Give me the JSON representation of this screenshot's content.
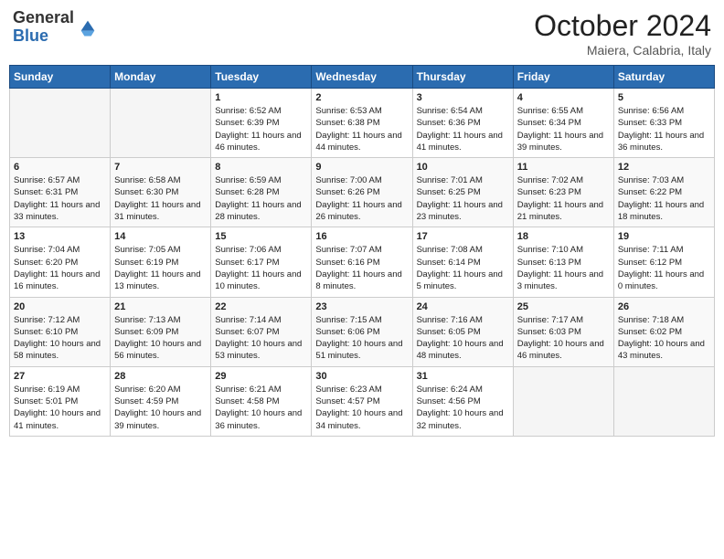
{
  "header": {
    "logo_general": "General",
    "logo_blue": "Blue",
    "month_year": "October 2024",
    "location": "Maiera, Calabria, Italy"
  },
  "days_of_week": [
    "Sunday",
    "Monday",
    "Tuesday",
    "Wednesday",
    "Thursday",
    "Friday",
    "Saturday"
  ],
  "weeks": [
    [
      {
        "day": null,
        "content": ""
      },
      {
        "day": null,
        "content": ""
      },
      {
        "day": "1",
        "content": "Sunrise: 6:52 AM\nSunset: 6:39 PM\nDaylight: 11 hours and 46 minutes."
      },
      {
        "day": "2",
        "content": "Sunrise: 6:53 AM\nSunset: 6:38 PM\nDaylight: 11 hours and 44 minutes."
      },
      {
        "day": "3",
        "content": "Sunrise: 6:54 AM\nSunset: 6:36 PM\nDaylight: 11 hours and 41 minutes."
      },
      {
        "day": "4",
        "content": "Sunrise: 6:55 AM\nSunset: 6:34 PM\nDaylight: 11 hours and 39 minutes."
      },
      {
        "day": "5",
        "content": "Sunrise: 6:56 AM\nSunset: 6:33 PM\nDaylight: 11 hours and 36 minutes."
      }
    ],
    [
      {
        "day": "6",
        "content": "Sunrise: 6:57 AM\nSunset: 6:31 PM\nDaylight: 11 hours and 33 minutes."
      },
      {
        "day": "7",
        "content": "Sunrise: 6:58 AM\nSunset: 6:30 PM\nDaylight: 11 hours and 31 minutes."
      },
      {
        "day": "8",
        "content": "Sunrise: 6:59 AM\nSunset: 6:28 PM\nDaylight: 11 hours and 28 minutes."
      },
      {
        "day": "9",
        "content": "Sunrise: 7:00 AM\nSunset: 6:26 PM\nDaylight: 11 hours and 26 minutes."
      },
      {
        "day": "10",
        "content": "Sunrise: 7:01 AM\nSunset: 6:25 PM\nDaylight: 11 hours and 23 minutes."
      },
      {
        "day": "11",
        "content": "Sunrise: 7:02 AM\nSunset: 6:23 PM\nDaylight: 11 hours and 21 minutes."
      },
      {
        "day": "12",
        "content": "Sunrise: 7:03 AM\nSunset: 6:22 PM\nDaylight: 11 hours and 18 minutes."
      }
    ],
    [
      {
        "day": "13",
        "content": "Sunrise: 7:04 AM\nSunset: 6:20 PM\nDaylight: 11 hours and 16 minutes."
      },
      {
        "day": "14",
        "content": "Sunrise: 7:05 AM\nSunset: 6:19 PM\nDaylight: 11 hours and 13 minutes."
      },
      {
        "day": "15",
        "content": "Sunrise: 7:06 AM\nSunset: 6:17 PM\nDaylight: 11 hours and 10 minutes."
      },
      {
        "day": "16",
        "content": "Sunrise: 7:07 AM\nSunset: 6:16 PM\nDaylight: 11 hours and 8 minutes."
      },
      {
        "day": "17",
        "content": "Sunrise: 7:08 AM\nSunset: 6:14 PM\nDaylight: 11 hours and 5 minutes."
      },
      {
        "day": "18",
        "content": "Sunrise: 7:10 AM\nSunset: 6:13 PM\nDaylight: 11 hours and 3 minutes."
      },
      {
        "day": "19",
        "content": "Sunrise: 7:11 AM\nSunset: 6:12 PM\nDaylight: 11 hours and 0 minutes."
      }
    ],
    [
      {
        "day": "20",
        "content": "Sunrise: 7:12 AM\nSunset: 6:10 PM\nDaylight: 10 hours and 58 minutes."
      },
      {
        "day": "21",
        "content": "Sunrise: 7:13 AM\nSunset: 6:09 PM\nDaylight: 10 hours and 56 minutes."
      },
      {
        "day": "22",
        "content": "Sunrise: 7:14 AM\nSunset: 6:07 PM\nDaylight: 10 hours and 53 minutes."
      },
      {
        "day": "23",
        "content": "Sunrise: 7:15 AM\nSunset: 6:06 PM\nDaylight: 10 hours and 51 minutes."
      },
      {
        "day": "24",
        "content": "Sunrise: 7:16 AM\nSunset: 6:05 PM\nDaylight: 10 hours and 48 minutes."
      },
      {
        "day": "25",
        "content": "Sunrise: 7:17 AM\nSunset: 6:03 PM\nDaylight: 10 hours and 46 minutes."
      },
      {
        "day": "26",
        "content": "Sunrise: 7:18 AM\nSunset: 6:02 PM\nDaylight: 10 hours and 43 minutes."
      }
    ],
    [
      {
        "day": "27",
        "content": "Sunrise: 6:19 AM\nSunset: 5:01 PM\nDaylight: 10 hours and 41 minutes."
      },
      {
        "day": "28",
        "content": "Sunrise: 6:20 AM\nSunset: 4:59 PM\nDaylight: 10 hours and 39 minutes."
      },
      {
        "day": "29",
        "content": "Sunrise: 6:21 AM\nSunset: 4:58 PM\nDaylight: 10 hours and 36 minutes."
      },
      {
        "day": "30",
        "content": "Sunrise: 6:23 AM\nSunset: 4:57 PM\nDaylight: 10 hours and 34 minutes."
      },
      {
        "day": "31",
        "content": "Sunrise: 6:24 AM\nSunset: 4:56 PM\nDaylight: 10 hours and 32 minutes."
      },
      {
        "day": null,
        "content": ""
      },
      {
        "day": null,
        "content": ""
      }
    ]
  ]
}
